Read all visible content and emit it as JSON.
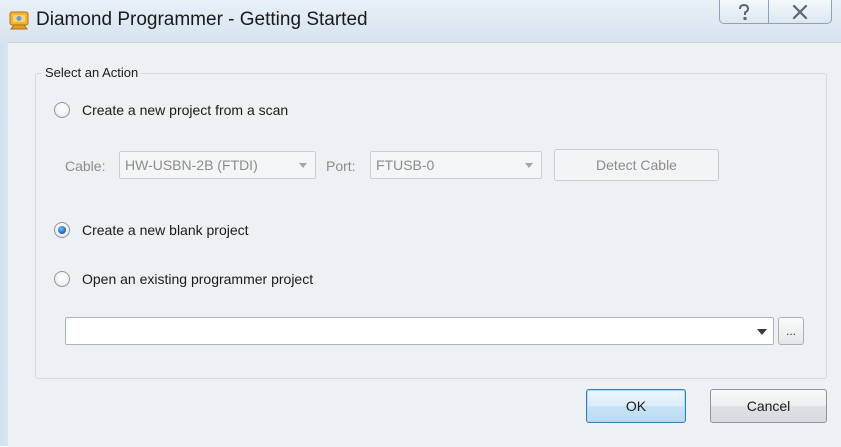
{
  "window": {
    "title": "Diamond Programmer - Getting Started"
  },
  "group": {
    "title": "Select an Action"
  },
  "options": {
    "scan": {
      "label": "Create a new project from a scan",
      "selected": false
    },
    "blank": {
      "label": "Create a new blank project",
      "selected": true
    },
    "existing": {
      "label": "Open an existing programmer project",
      "selected": false
    }
  },
  "scan_settings": {
    "cable_label": "Cable:",
    "cable_value": "HW-USBN-2B (FTDI)",
    "port_label": "Port:",
    "port_value": "FTUSB-0",
    "detect_label": "Detect Cable"
  },
  "project_path": {
    "value": "",
    "browse_label": "..."
  },
  "buttons": {
    "ok": "OK",
    "cancel": "Cancel"
  },
  "icons": {
    "app": "diamond-programmer-icon",
    "help": "help-icon",
    "close": "close-icon",
    "dropdown": "chevron-down-icon"
  },
  "colors": {
    "title_bar": "#dfe9f3",
    "client_bg": "#eef1f4",
    "radio_selected": "#1f6fbd",
    "ok_border": "#3c7fb1",
    "disabled_text": "#8c8c8c"
  }
}
